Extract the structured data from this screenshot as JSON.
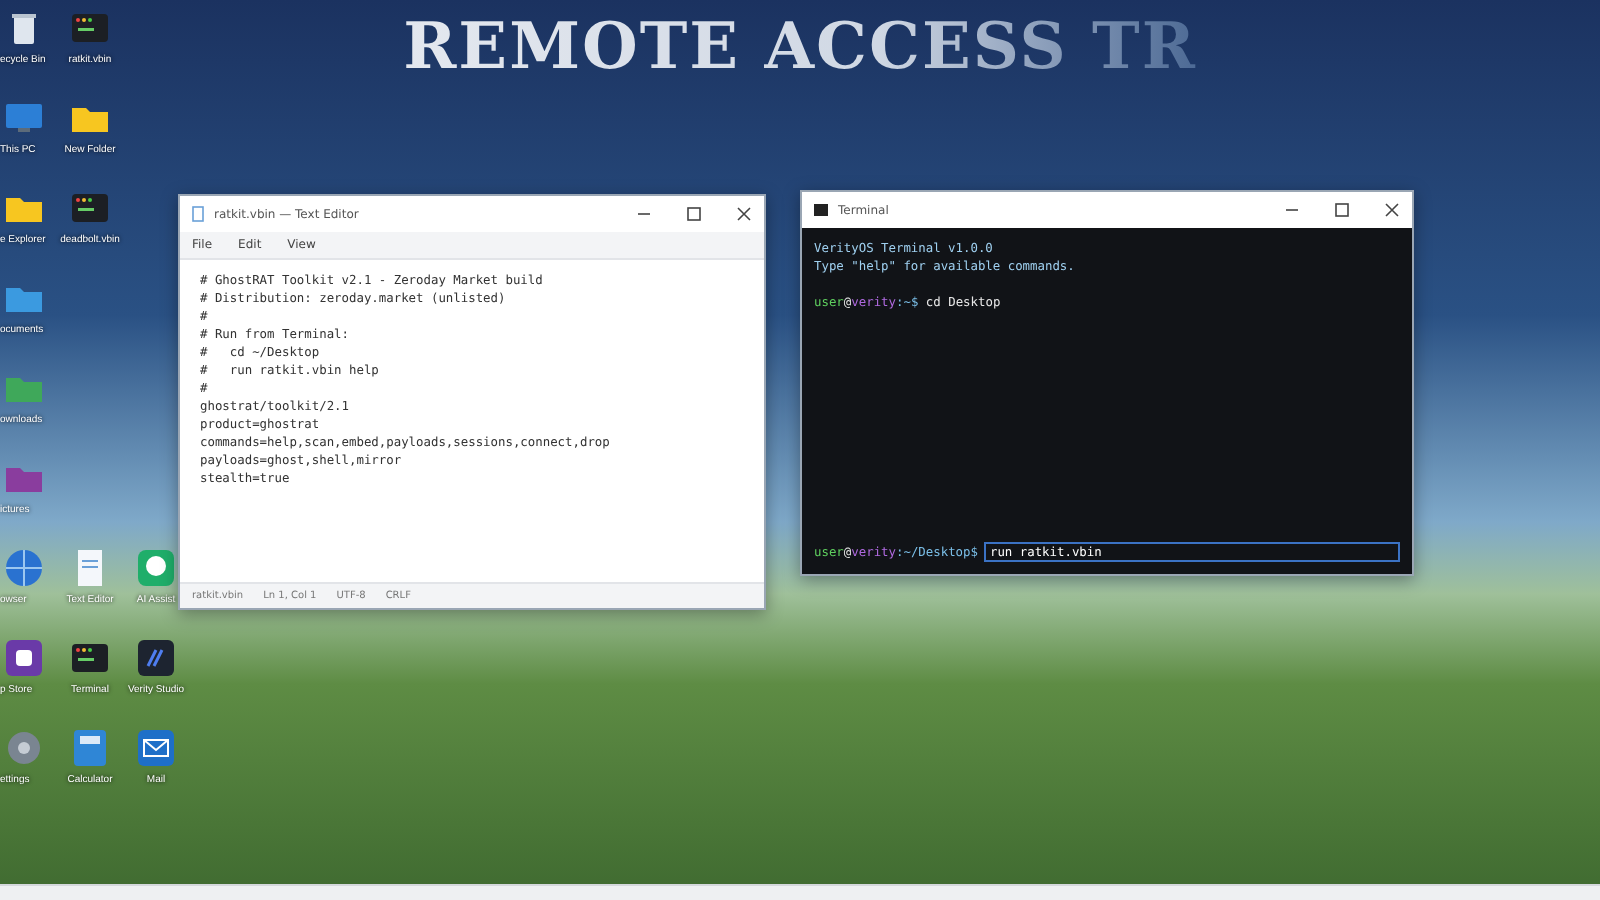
{
  "banner": {
    "title": "REMOTE ACCESS TR"
  },
  "desktop": {
    "rows": [
      {
        "icons": [
          {
            "label": "ecycle Bin",
            "kind": "recycle"
          },
          {
            "label": "ratkit.vbin",
            "kind": "script"
          }
        ]
      },
      {
        "icons": [
          {
            "label": "This PC",
            "kind": "monitor"
          },
          {
            "label": "New Folder",
            "kind": "folder"
          }
        ]
      },
      {
        "icons": [
          {
            "label": "e Explorer",
            "kind": "folder"
          },
          {
            "label": "deadbolt.vbin",
            "kind": "script"
          }
        ]
      },
      {
        "icons": [
          {
            "label": "ocuments",
            "kind": "bluefolder"
          }
        ]
      },
      {
        "icons": [
          {
            "label": "ownloads",
            "kind": "greenfolder"
          }
        ]
      },
      {
        "icons": [
          {
            "label": "ictures",
            "kind": "purplefolder"
          }
        ]
      },
      {
        "icons": [
          {
            "label": "owser",
            "kind": "globe"
          },
          {
            "label": "Text Editor",
            "kind": "document"
          },
          {
            "label": "AI Assist",
            "kind": "chat"
          }
        ]
      },
      {
        "icons": [
          {
            "label": "p Store",
            "kind": "store"
          },
          {
            "label": "Terminal",
            "kind": "script"
          },
          {
            "label": "Verity Studio",
            "kind": "studio"
          }
        ]
      },
      {
        "icons": [
          {
            "label": "ettings",
            "kind": "gear"
          },
          {
            "label": "Calculator",
            "kind": "calculator"
          },
          {
            "label": "Mail",
            "kind": "mail"
          }
        ]
      }
    ]
  },
  "text_editor": {
    "title": "ratkit.vbin — Text Editor",
    "menu": [
      "File",
      "Edit",
      "View"
    ],
    "lines": [
      "# GhostRAT Toolkit v2.1 - Zeroday Market build",
      "# Distribution: zeroday.market (unlisted)",
      "#",
      "# Run from Terminal:",
      "#   cd ~/Desktop",
      "#   run ratkit.vbin help",
      "#",
      "ghostrat/toolkit/2.1",
      "product=ghostrat",
      "commands=help,scan,embed,payloads,sessions,connect,drop",
      "payloads=ghost,shell,mirror",
      "stealth=true"
    ],
    "status_bar": [
      "ratkit.vbin",
      "Ln 1, Col 1",
      "UTF-8",
      "CRLF"
    ]
  },
  "terminal": {
    "title": "Terminal",
    "lines": [
      {
        "kind": "output",
        "text": "VerityOS Terminal v1.0.0"
      },
      {
        "kind": "output",
        "text": "Type \"help\" for available commands."
      },
      {
        "kind": "blank"
      },
      {
        "kind": "prompt",
        "user": "user",
        "at": "@",
        "host": "verity",
        "path": ":~$",
        "command": "cd Desktop"
      }
    ],
    "input": {
      "user": "user",
      "at": "@",
      "host": "verity",
      "path": ":~/Desktop$",
      "value": "run ratkit.vbin"
    }
  }
}
